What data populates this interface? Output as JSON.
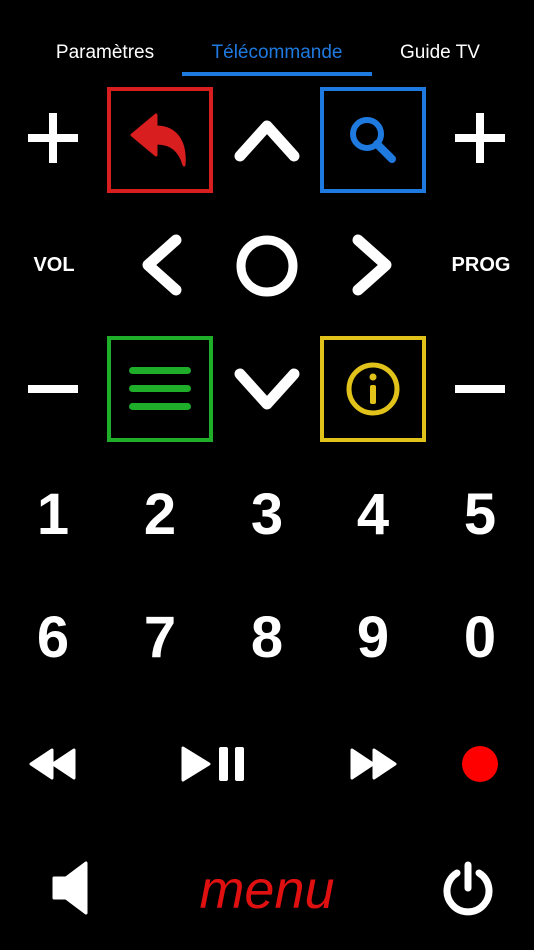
{
  "tabs": [
    {
      "label": "Paramètres",
      "active": false
    },
    {
      "label": "Télécommande",
      "active": true
    },
    {
      "label": "Guide TV",
      "active": false
    }
  ],
  "colors": {
    "background": "#000000",
    "foreground": "#ffffff",
    "active_tab": "#1f7ae0",
    "back_button": "#d81e1e",
    "search_button": "#1f7ae0",
    "menu_button": "#1fae2a",
    "info_button": "#e0c21a",
    "record_button": "#ff0000",
    "menu_text": "#e01010"
  },
  "remote": {
    "volume_label": "VOL",
    "program_label": "PROG",
    "digits_row1": [
      "1",
      "2",
      "3",
      "4",
      "5"
    ],
    "digits_row2": [
      "6",
      "7",
      "8",
      "9",
      "0"
    ],
    "menu_label": "menu"
  },
  "icons": {
    "volume_up": "plus-icon",
    "volume_down": "minus-icon",
    "program_up": "plus-icon",
    "program_down": "minus-icon",
    "back": "back-arrow-icon",
    "search": "search-icon",
    "up": "chevron-up-icon",
    "down": "chevron-down-icon",
    "left": "chevron-left-icon",
    "right": "chevron-right-icon",
    "ok": "circle-ok-icon",
    "menu": "hamburger-icon",
    "info": "info-icon",
    "rewind": "rewind-icon",
    "play_pause": "play-pause-icon",
    "fast_forward": "fast-forward-icon",
    "record": "record-icon",
    "mute": "speaker-icon",
    "power": "power-icon"
  }
}
